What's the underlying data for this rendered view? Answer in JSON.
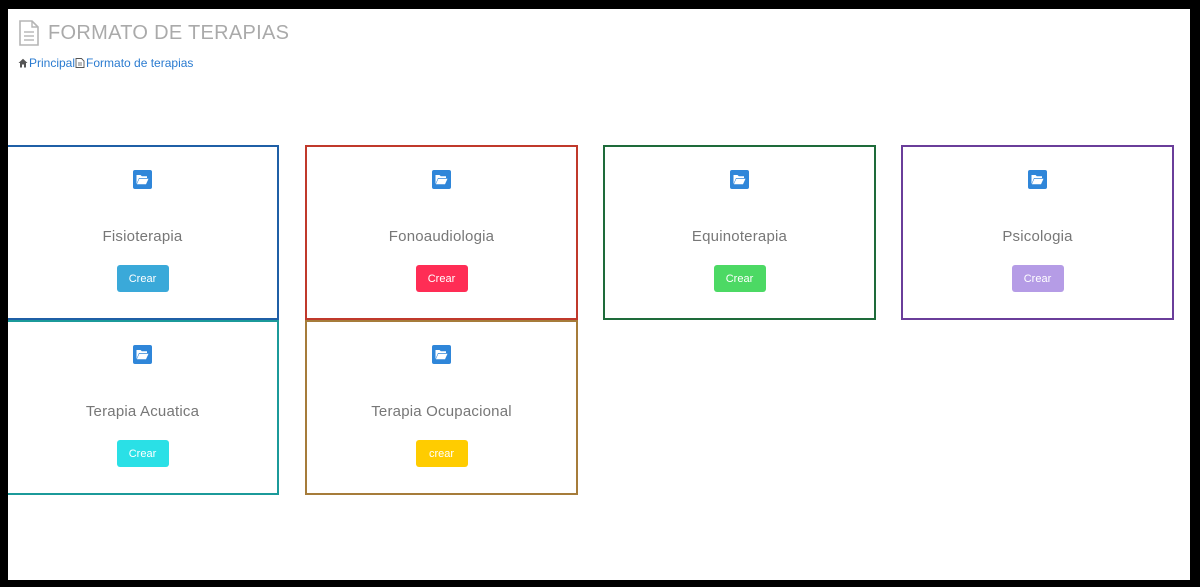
{
  "header": {
    "title": "FORMATO DE TERAPIAS",
    "icon": "document-icon"
  },
  "breadcrumb": {
    "items": [
      {
        "label": "Principal",
        "icon": "home-icon"
      },
      {
        "label": "Formato de terapias",
        "icon": "document-icon"
      }
    ]
  },
  "cards": [
    {
      "title": "Fisioterapia",
      "button": "Crear",
      "border_color": "#1f5fa6",
      "button_color": "#3aa9d9"
    },
    {
      "title": "Fonoaudiologia",
      "button": "Crear",
      "border_color": "#c0392b",
      "button_color": "#ff2d55"
    },
    {
      "title": "Equinoterapia",
      "button": "Crear",
      "border_color": "#1e6b3a",
      "button_color": "#4cd964"
    },
    {
      "title": "Psicologia",
      "button": "Crear",
      "border_color": "#6a3d9a",
      "button_color": "#b59ce6"
    },
    {
      "title": "Terapia Acuatica",
      "button": "Crear",
      "border_color": "#1b9a9a",
      "button_color": "#2ae0e6"
    },
    {
      "title": "Terapia Ocupacional",
      "button": "crear",
      "border_color": "#a67c3a",
      "button_color": "#ffcc00"
    }
  ]
}
